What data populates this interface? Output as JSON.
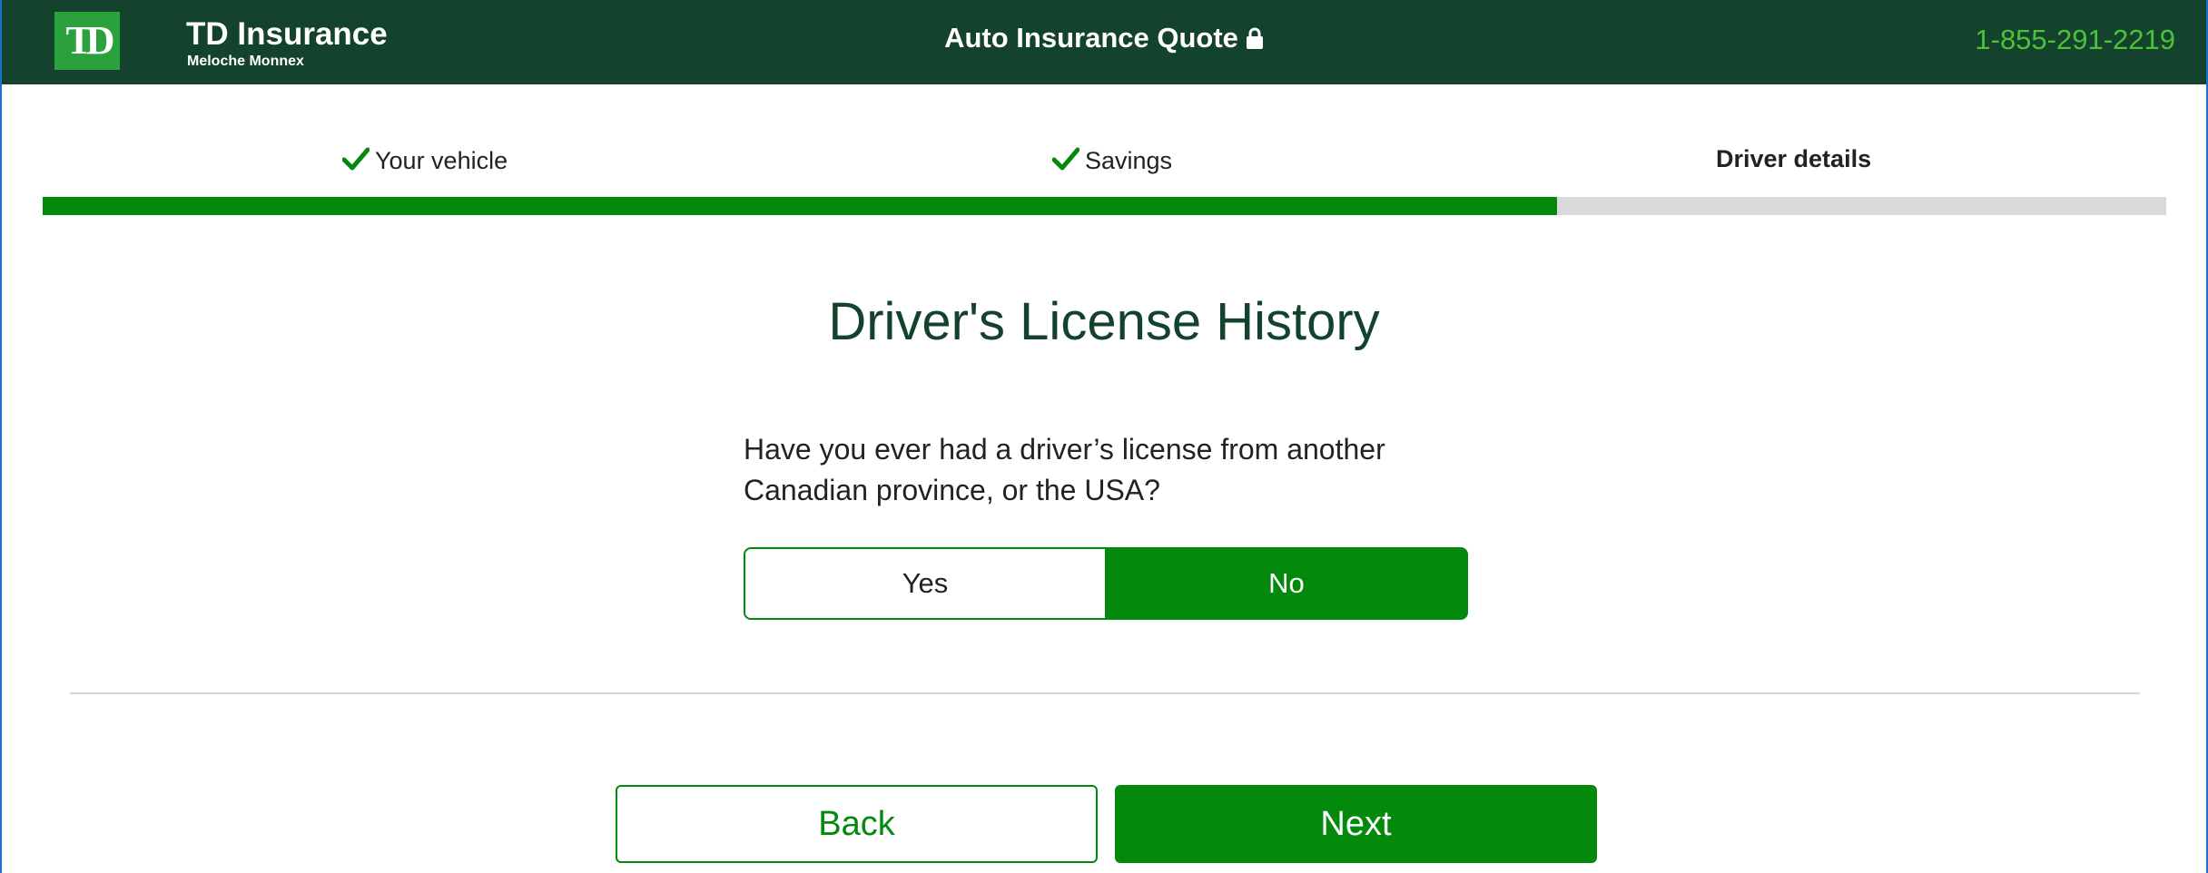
{
  "header": {
    "logo_text": "TD",
    "brand_name": "TD Insurance",
    "brand_sub": "Meloche Monnex",
    "title": "Auto Insurance Quote",
    "phone": "1-855-291-2219"
  },
  "progress": {
    "steps": [
      {
        "label": "Your vehicle",
        "status": "complete",
        "icon": "check-icon"
      },
      {
        "label": "Savings",
        "status": "complete",
        "icon": "check-icon"
      },
      {
        "label": "Driver details",
        "status": "current"
      }
    ],
    "completed_fraction": 0.713
  },
  "main": {
    "title": "Driver's License History",
    "question": "Have you ever had a driver’s license from another Canadian province, or the USA?",
    "options": [
      "Yes",
      "No"
    ],
    "selected": "No"
  },
  "footer": {
    "back_label": "Back",
    "next_label": "Next"
  },
  "colors": {
    "header_bg": "#13432c",
    "accent_green": "#038a0d",
    "logo_green": "#2aa13d",
    "phone_green": "#4cc23a",
    "track_grey": "#d9d9d9"
  }
}
